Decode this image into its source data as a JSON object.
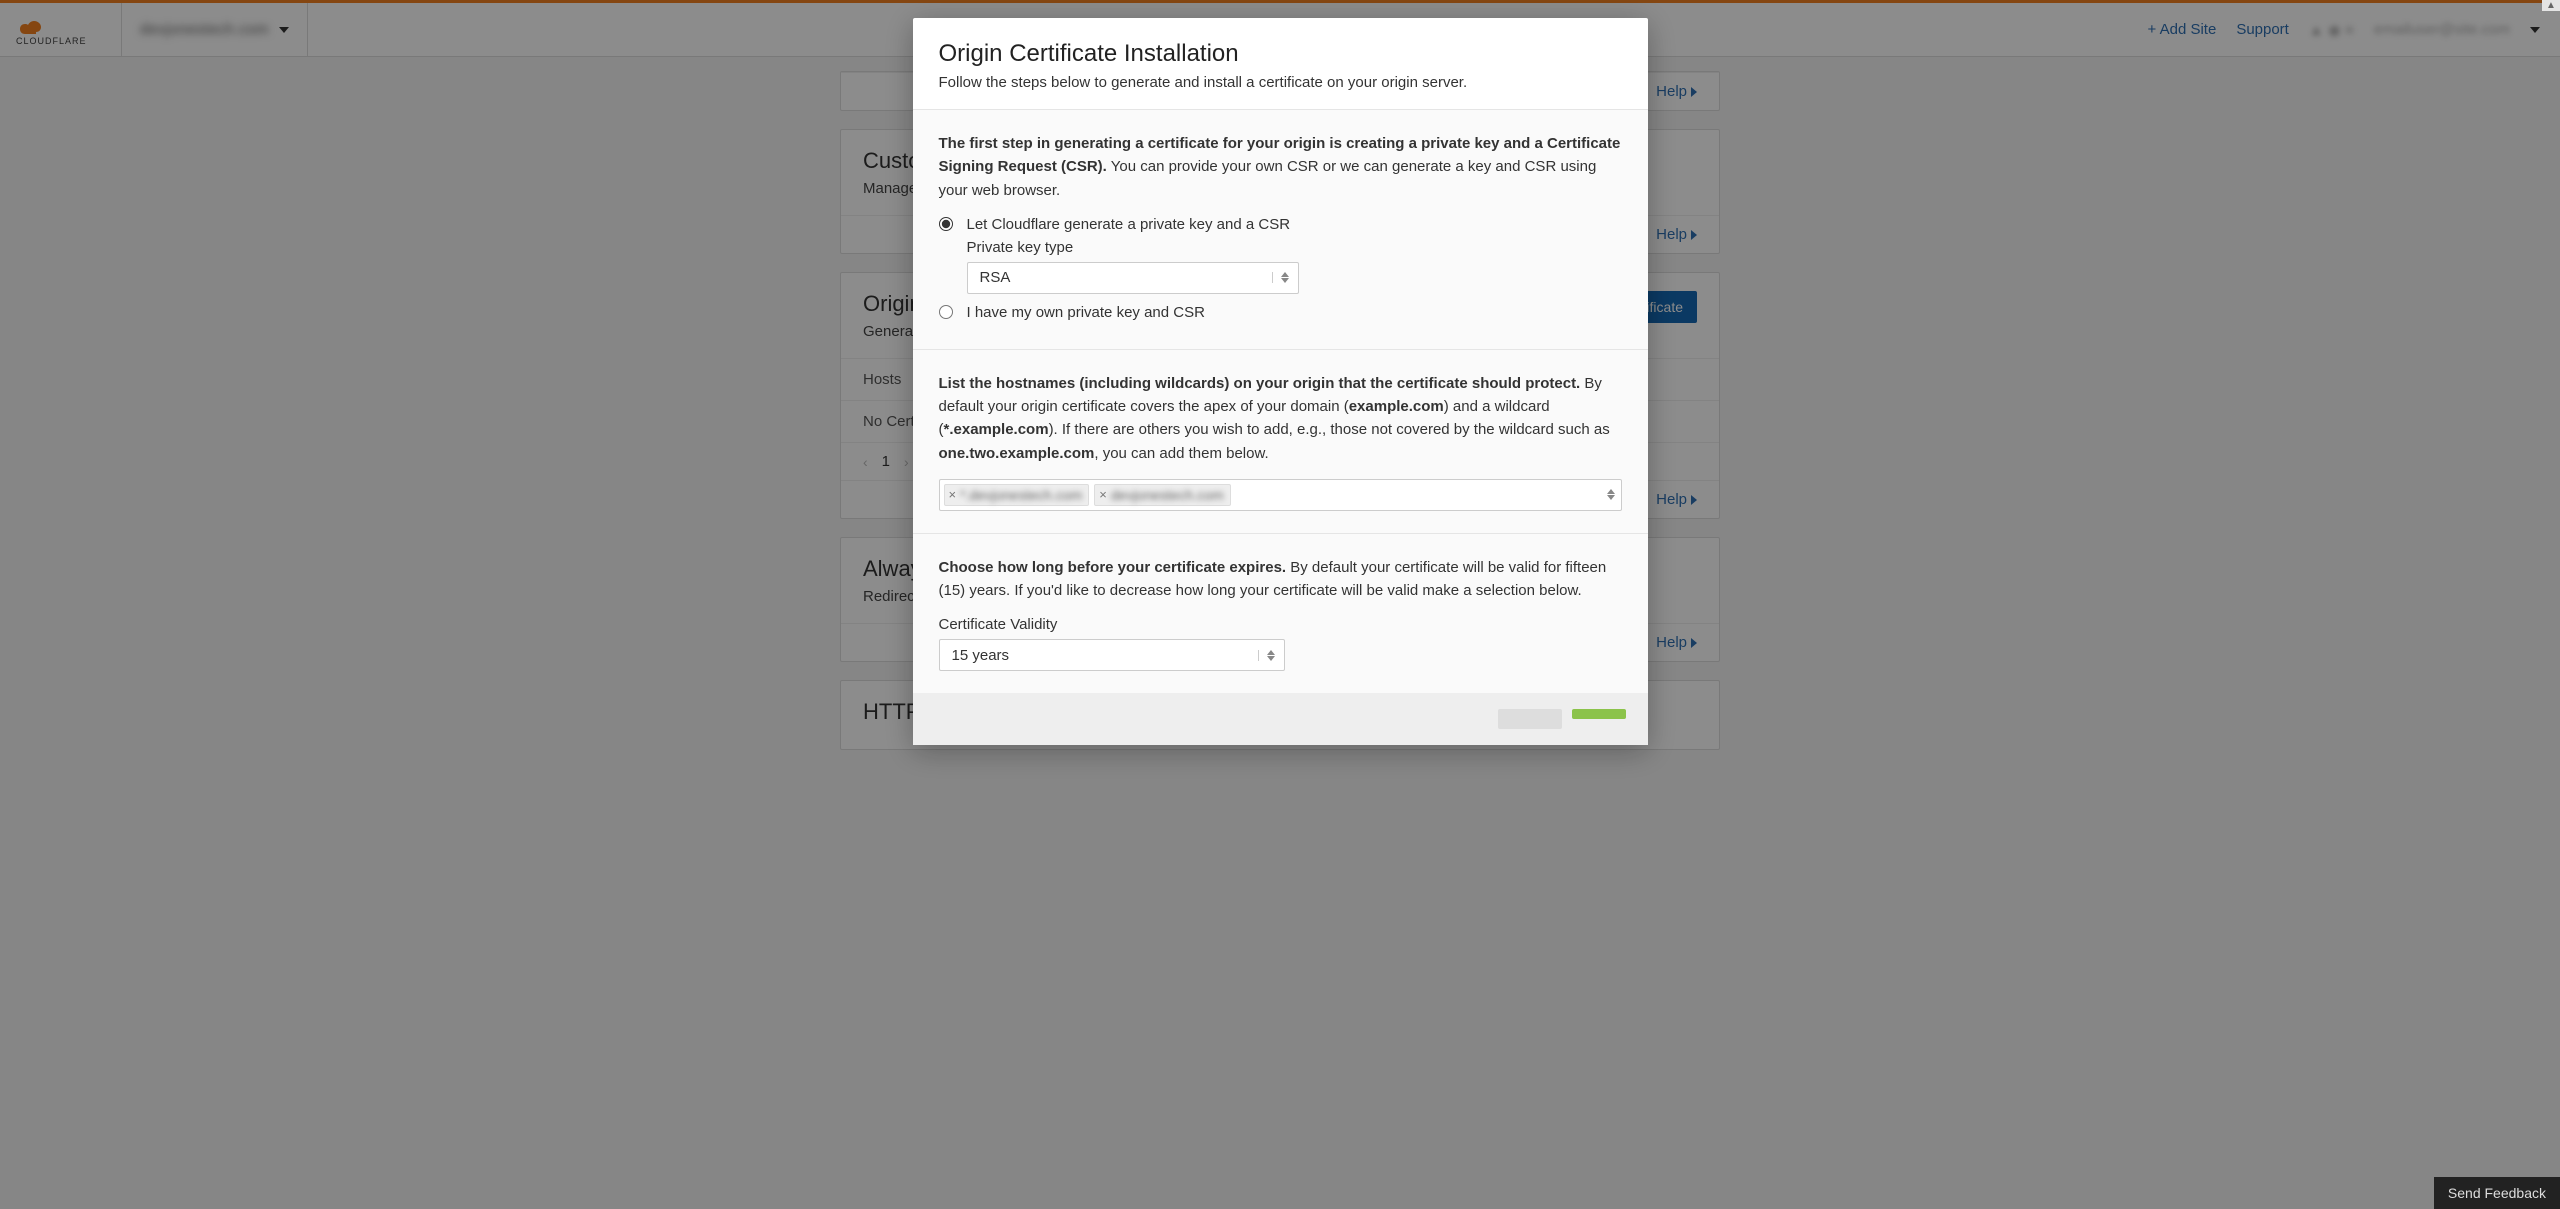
{
  "header": {
    "site_name": "devjonestech.com",
    "add_site": "+ Add Site",
    "support": "Support",
    "user_icons": "▲ ◉ ≡",
    "user_email": "emailuser@site.com"
  },
  "cards": {
    "help": "Help",
    "custom": {
      "title": "Custom Hostnames",
      "desc": "Manage the hostnames for which Cloudflare will serve your content."
    },
    "origin": {
      "title": "Origin Certificates",
      "desc": "Generate a free TLS certificate signed by Cloudflare to install on your origin server.",
      "create_btn": "Create Certificate",
      "hosts_header": "Hosts",
      "empty": "No Certificates.",
      "page": "1"
    },
    "always": {
      "title": "Always Use HTTPS",
      "desc": "Redirect all requests with scheme \"http\" to \"https\". This applies to all http requests to this zone."
    },
    "http": {
      "title": "HTTP Strict Transport Security (HSTS)"
    }
  },
  "modal": {
    "title": "Origin Certificate Installation",
    "subtitle": "Follow the steps below to generate and install a certificate on your origin server.",
    "step1_strong": "The first step in generating a certificate for your origin is creating a private key and a Certificate Signing Request (CSR).",
    "step1_rest": " You can provide your own CSR or we can generate a key and CSR using your web browser.",
    "radio_generate": "Let Cloudflare generate a private key and a CSR",
    "radio_own": "I have my own private key and CSR",
    "pk_label": "Private key type",
    "pk_value": "RSA",
    "hosts_strong": "List the hostnames (including wildcards) on your origin that the certificate should protect.",
    "hosts_p1a": " By default your origin certificate covers the apex of your domain (",
    "hosts_ex1": "example.com",
    "hosts_p1b": ") and a wildcard (",
    "hosts_ex2": "*.example.com",
    "hosts_p1c": "). If there are others you wish to add, e.g., those not covered by the wildcard such as ",
    "hosts_ex3": "one.two.example.com",
    "hosts_p1d": ", you can add them below.",
    "token1": "*.devjonestech.com",
    "token2": "devjonestech.com",
    "expire_strong": "Choose how long before your certificate expires.",
    "expire_rest": " By default your certificate will be valid for fifteen (15) years. If you'd like to decrease how long your certificate will be valid make a selection below.",
    "validity_label": "Certificate Validity",
    "validity_value": "15 years"
  },
  "feedback": "Send Feedback"
}
